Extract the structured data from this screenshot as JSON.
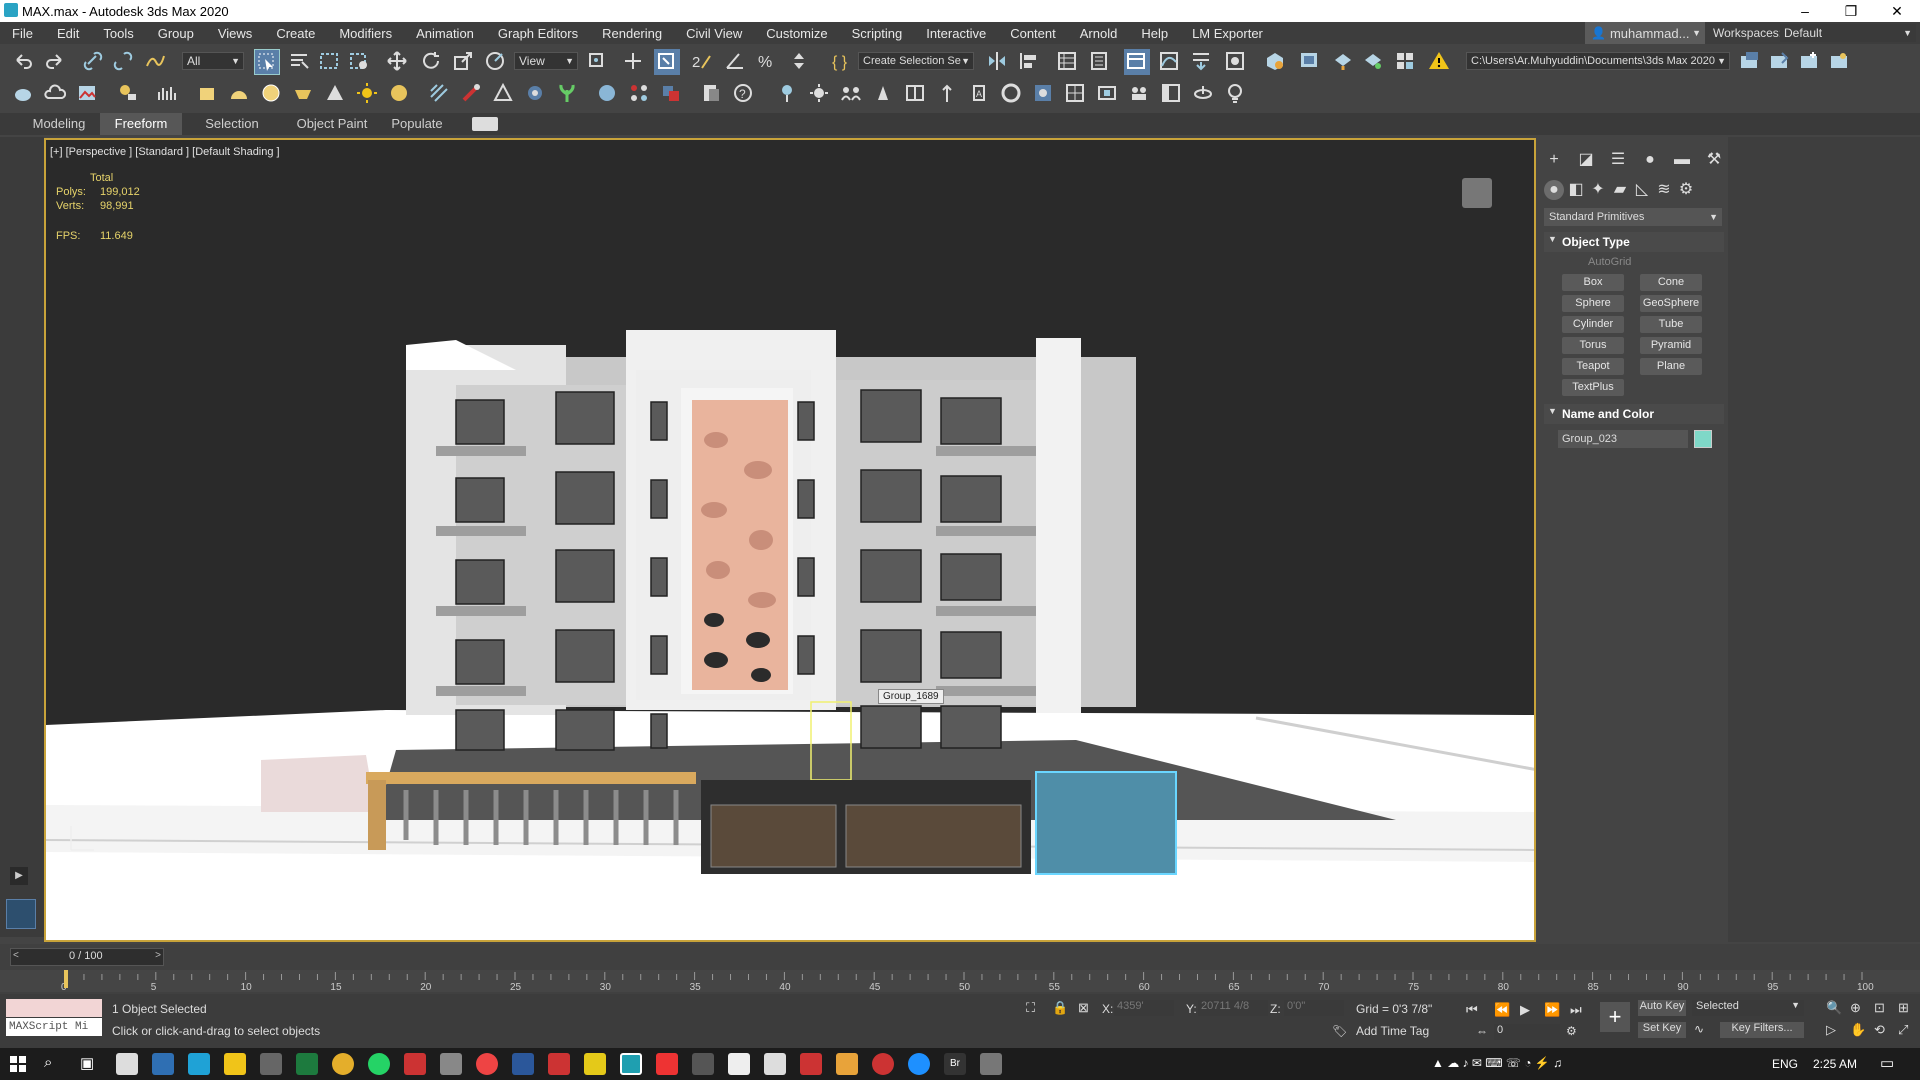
{
  "window": {
    "title": "MAX.max - Autodesk 3ds Max 2020",
    "controls": [
      "–",
      "❐",
      "✕"
    ]
  },
  "menu": [
    "File",
    "Edit",
    "Tools",
    "Group",
    "Views",
    "Create",
    "Modifiers",
    "Animation",
    "Graph Editors",
    "Rendering",
    "Civil View",
    "Customize",
    "Scripting",
    "Interactive",
    "Content",
    "Arnold",
    "Help",
    "LM Exporter"
  ],
  "account": {
    "user": "muhammad...",
    "workspaces_label": "Workspaces:",
    "workspace": "Default"
  },
  "toolbar": {
    "selection_filter": "All",
    "ref_coord": "View",
    "named_selection": "Create Selection Se",
    "project_path": "C:\\Users\\Ar.Muhyuddin\\Documents\\3ds Max 2020"
  },
  "ribbon_tabs": [
    "Modeling",
    "Freeform",
    "Selection",
    "Object Paint",
    "Populate"
  ],
  "viewport": {
    "label": "[+] [Perspective ] [Standard ] [Default Shading ]",
    "stats_total": "Total",
    "polys_label": "Polys:",
    "polys_value": "199,012",
    "verts_label": "Verts:",
    "verts_value": "98,991",
    "fps_label": "FPS:",
    "fps_value": "11.649",
    "tooltip": "Group_1689"
  },
  "command_panel": {
    "category": "Standard Primitives",
    "object_type_header": "Object Type",
    "autogrid": "AutoGrid",
    "buttons": [
      "Box",
      "Cone",
      "Sphere",
      "GeoSphere",
      "Cylinder",
      "Tube",
      "Torus",
      "Pyramid",
      "Teapot",
      "Plane",
      "TextPlus"
    ],
    "name_color_header": "Name and Color",
    "object_name": "Group_023",
    "object_color": "#7fd8c8"
  },
  "timeline": {
    "frame_slider": "0 / 100",
    "ticks": [
      "0",
      "5",
      "10",
      "15",
      "20",
      "25",
      "30",
      "35",
      "40",
      "45",
      "50",
      "55",
      "60",
      "65",
      "70",
      "75",
      "80",
      "85",
      "90",
      "95",
      "100"
    ]
  },
  "status": {
    "maxscript": "MAXScript Mi",
    "selected": "1 Object Selected",
    "prompt": "Click or click-and-drag to select objects",
    "x_label": "X:",
    "x_value": "4359'",
    "y_label": "Y:",
    "y_value": "20711 4/8",
    "z_label": "Z:",
    "z_value": "0'0\"",
    "grid": "Grid = 0'3 7/8\"",
    "add_time_tag": "Add Time Tag",
    "auto_key": "Auto Key",
    "selected_dropdown": "Selected",
    "set_key": "Set Key",
    "key_filters": "Key Filters...",
    "frame_value": "0"
  },
  "taskbar": {
    "lang": "ENG",
    "time": "2:25 AM"
  }
}
